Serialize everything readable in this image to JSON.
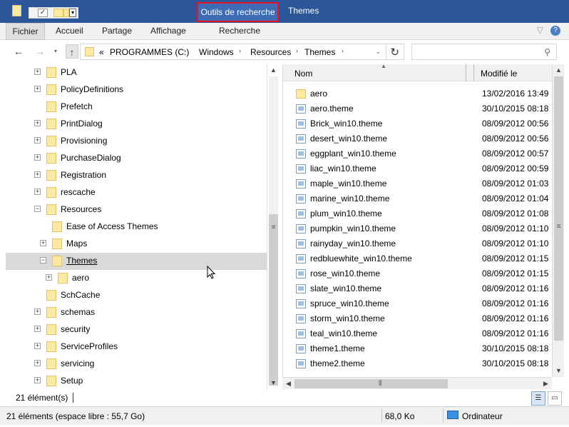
{
  "titlebar": {
    "tool_tab": "Outils de recherche",
    "title": "Themes"
  },
  "ribbon": {
    "tabs": [
      "Fichier",
      "Accueil",
      "Partage",
      "Affichage",
      "Recherche"
    ],
    "chevron": "▽",
    "help": "?"
  },
  "addressbar": {
    "segments": [
      "«",
      "PROGRAMMES (C:)",
      "Windows",
      "Resources",
      "Themes"
    ],
    "search_placeholder": ""
  },
  "tree": [
    {
      "label": "PLA",
      "expand": "+",
      "level": 0
    },
    {
      "label": "PolicyDefinitions",
      "expand": "+",
      "level": 0
    },
    {
      "label": "Prefetch",
      "expand": "",
      "level": 0
    },
    {
      "label": "PrintDialog",
      "expand": "+",
      "level": 0
    },
    {
      "label": "Provisioning",
      "expand": "+",
      "level": 0
    },
    {
      "label": "PurchaseDialog",
      "expand": "+",
      "level": 0
    },
    {
      "label": "Registration",
      "expand": "+",
      "level": 0
    },
    {
      "label": "rescache",
      "expand": "+",
      "level": 0
    },
    {
      "label": "Resources",
      "expand": "−",
      "level": 0
    },
    {
      "label": "Ease of Access Themes",
      "expand": "",
      "level": 1
    },
    {
      "label": "Maps",
      "expand": "+",
      "level": 1
    },
    {
      "label": "Themes",
      "expand": "−",
      "level": 1,
      "selected": true
    },
    {
      "label": "aero",
      "expand": "+",
      "level": 2
    },
    {
      "label": "SchCache",
      "expand": "",
      "level": 0
    },
    {
      "label": "schemas",
      "expand": "+",
      "level": 0
    },
    {
      "label": "security",
      "expand": "+",
      "level": 0
    },
    {
      "label": "ServiceProfiles",
      "expand": "+",
      "level": 0
    },
    {
      "label": "servicing",
      "expand": "+",
      "level": 0
    },
    {
      "label": "Setup",
      "expand": "+",
      "level": 0
    }
  ],
  "columns": {
    "name": "Nom",
    "date": "Modifié le"
  },
  "files": [
    {
      "name": "aero",
      "date": "13/02/2016 13:49",
      "type": "folder"
    },
    {
      "name": "aero.theme",
      "date": "30/10/2015 08:18",
      "type": "theme"
    },
    {
      "name": "Brick_win10.theme",
      "date": "08/09/2012 00:56",
      "type": "theme"
    },
    {
      "name": "desert_win10.theme",
      "date": "08/09/2012 00:56",
      "type": "theme"
    },
    {
      "name": "eggplant_win10.theme",
      "date": "08/09/2012 00:57",
      "type": "theme"
    },
    {
      "name": "liac_win10.theme",
      "date": "08/09/2012 00:59",
      "type": "theme"
    },
    {
      "name": "maple_win10.theme",
      "date": "08/09/2012 01:03",
      "type": "theme"
    },
    {
      "name": "marine_win10.theme",
      "date": "08/09/2012 01:04",
      "type": "theme"
    },
    {
      "name": "plum_win10.theme",
      "date": "08/09/2012 01:08",
      "type": "theme"
    },
    {
      "name": "pumpkin_win10.theme",
      "date": "08/09/2012 01:10",
      "type": "theme"
    },
    {
      "name": "rainyday_win10.theme",
      "date": "08/09/2012 01:10",
      "type": "theme"
    },
    {
      "name": "redbluewhite_win10.theme",
      "date": "08/09/2012 01:15",
      "type": "theme"
    },
    {
      "name": "rose_win10.theme",
      "date": "08/09/2012 01:15",
      "type": "theme"
    },
    {
      "name": "slate_win10.theme",
      "date": "08/09/2012 01:16",
      "type": "theme"
    },
    {
      "name": "spruce_win10.theme",
      "date": "08/09/2012 01:16",
      "type": "theme"
    },
    {
      "name": "storm_win10.theme",
      "date": "08/09/2012 01:16",
      "type": "theme"
    },
    {
      "name": "teal_win10.theme",
      "date": "08/09/2012 01:16",
      "type": "theme"
    },
    {
      "name": "theme1.theme",
      "date": "30/10/2015 08:18",
      "type": "theme"
    },
    {
      "name": "theme2.theme",
      "date": "30/10/2015 08:18",
      "type": "theme"
    }
  ],
  "status": {
    "count": "21 élément(s)",
    "bottom_left": "21 éléments (espace libre : 55,7 Go)",
    "bottom_size": "68,0 Ko",
    "bottom_location": "Ordinateur"
  },
  "icons": {
    "back": "back-arrow-icon",
    "forward": "forward-arrow-icon",
    "up": "up-arrow-icon",
    "refresh": "refresh-icon",
    "search": "search-icon"
  },
  "colors": {
    "titlebar": "#2b579a",
    "tool_tab_border": "#e81123",
    "folder": "#fde9a2",
    "selection": "#d9d9d9"
  }
}
